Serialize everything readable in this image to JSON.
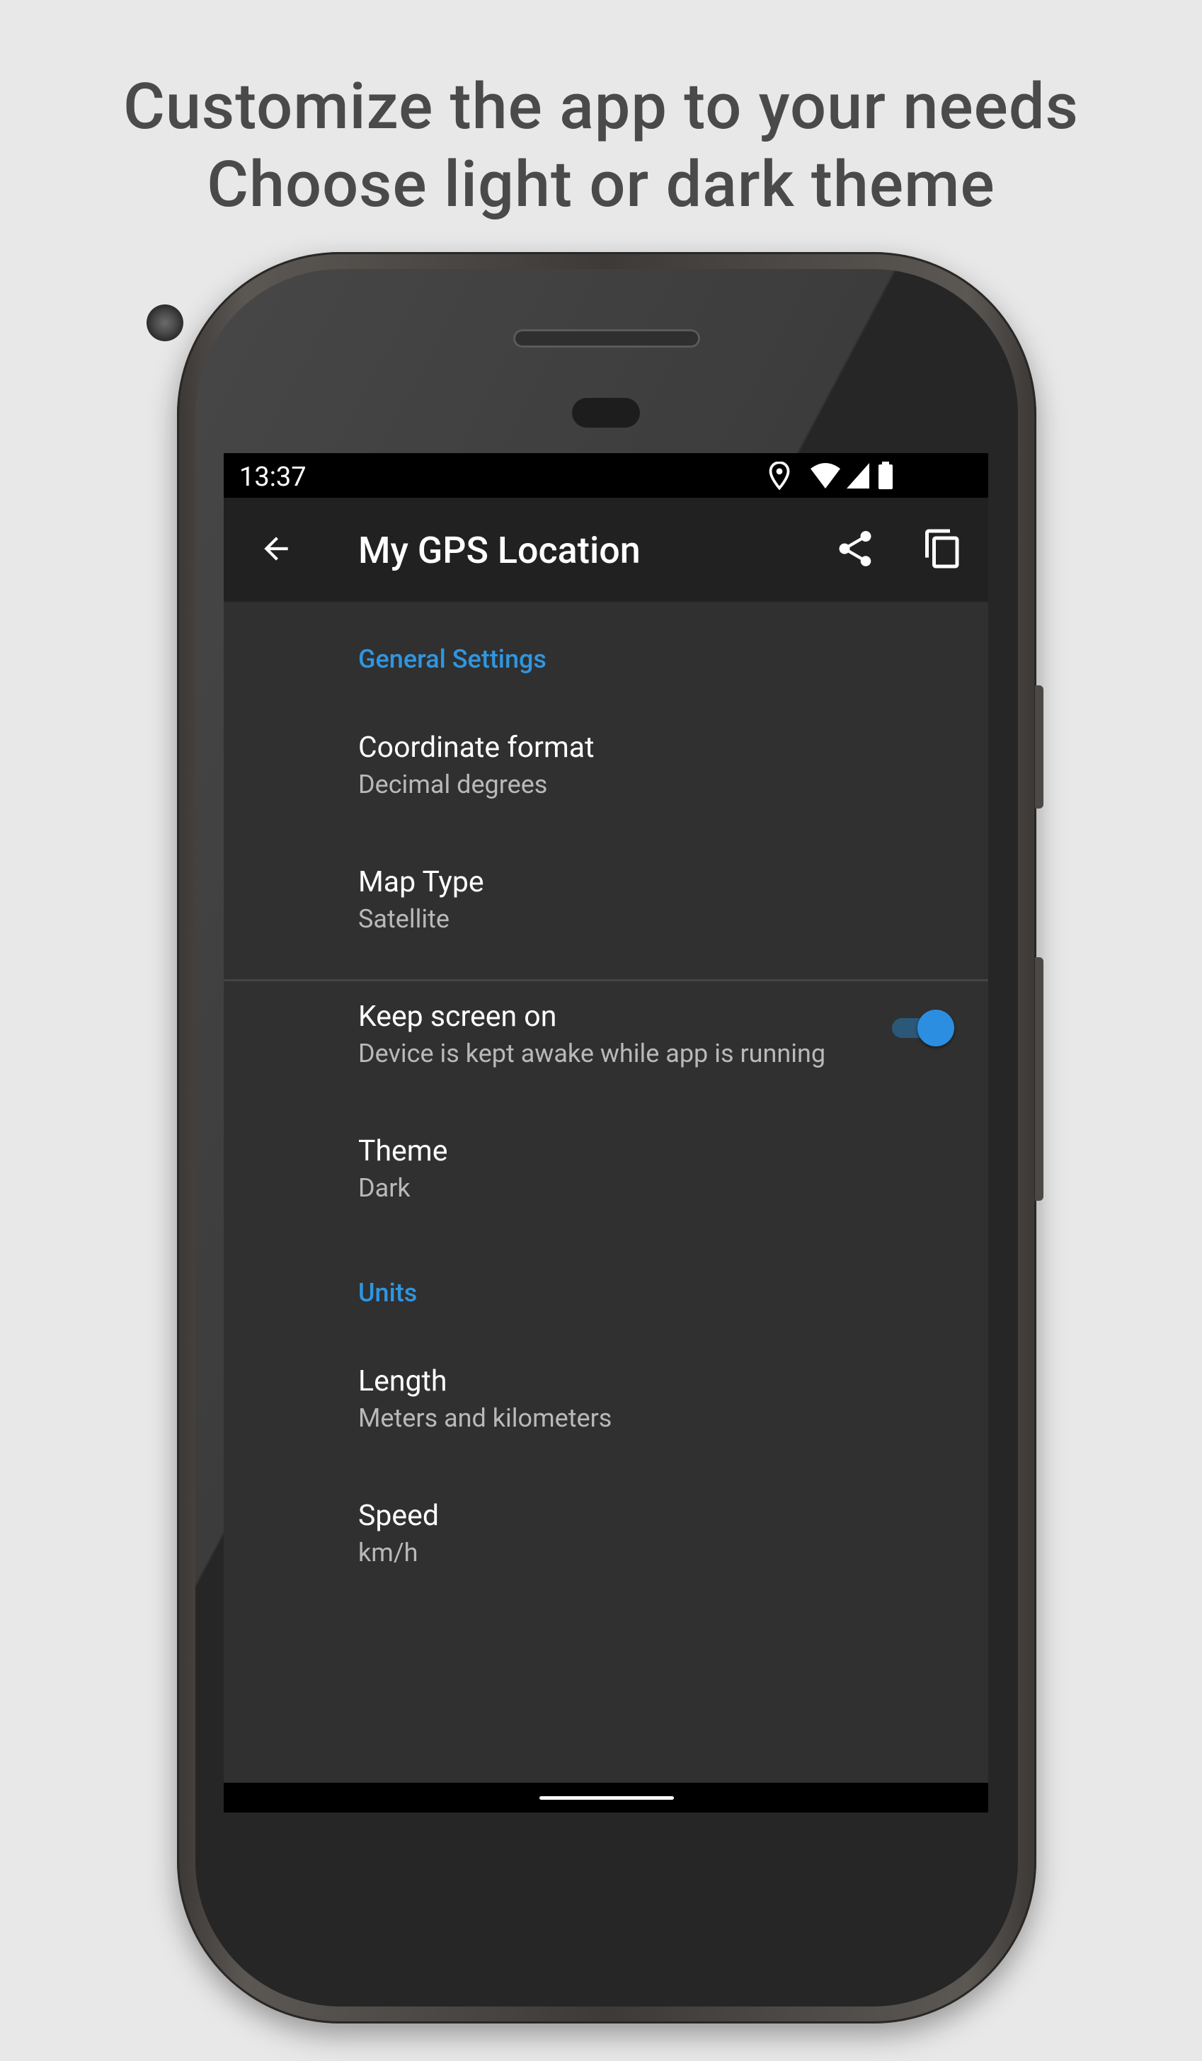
{
  "headline": {
    "line1": "Customize the app to your needs",
    "line2": "Choose light or dark theme"
  },
  "status_bar": {
    "time": "13:37",
    "icons": [
      "location-icon",
      "wifi-icon",
      "signal-icon",
      "battery-icon"
    ]
  },
  "app_bar": {
    "title": "My GPS Location",
    "icons": [
      "back-arrow-icon",
      "share-icon",
      "copy-icon"
    ]
  },
  "settings": {
    "general": {
      "header": "General Settings",
      "coordinate_format": {
        "title": "Coordinate format",
        "summary": "Decimal degrees"
      },
      "map_type": {
        "title": "Map Type",
        "summary": "Satellite"
      },
      "keep_screen_on": {
        "title": "Keep screen on",
        "summary": "Device is kept awake while app is running",
        "enabled": true
      },
      "theme": {
        "title": "Theme",
        "summary": "Dark"
      }
    },
    "units": {
      "header": "Units",
      "length": {
        "title": "Length",
        "summary": "Meters and kilometers"
      },
      "speed": {
        "title": "Speed",
        "summary": "km/h"
      }
    }
  },
  "colors": {
    "accent": "#2f96e0",
    "background": "#303030",
    "app_bar": "#212121",
    "page": "#e8e8e8"
  }
}
